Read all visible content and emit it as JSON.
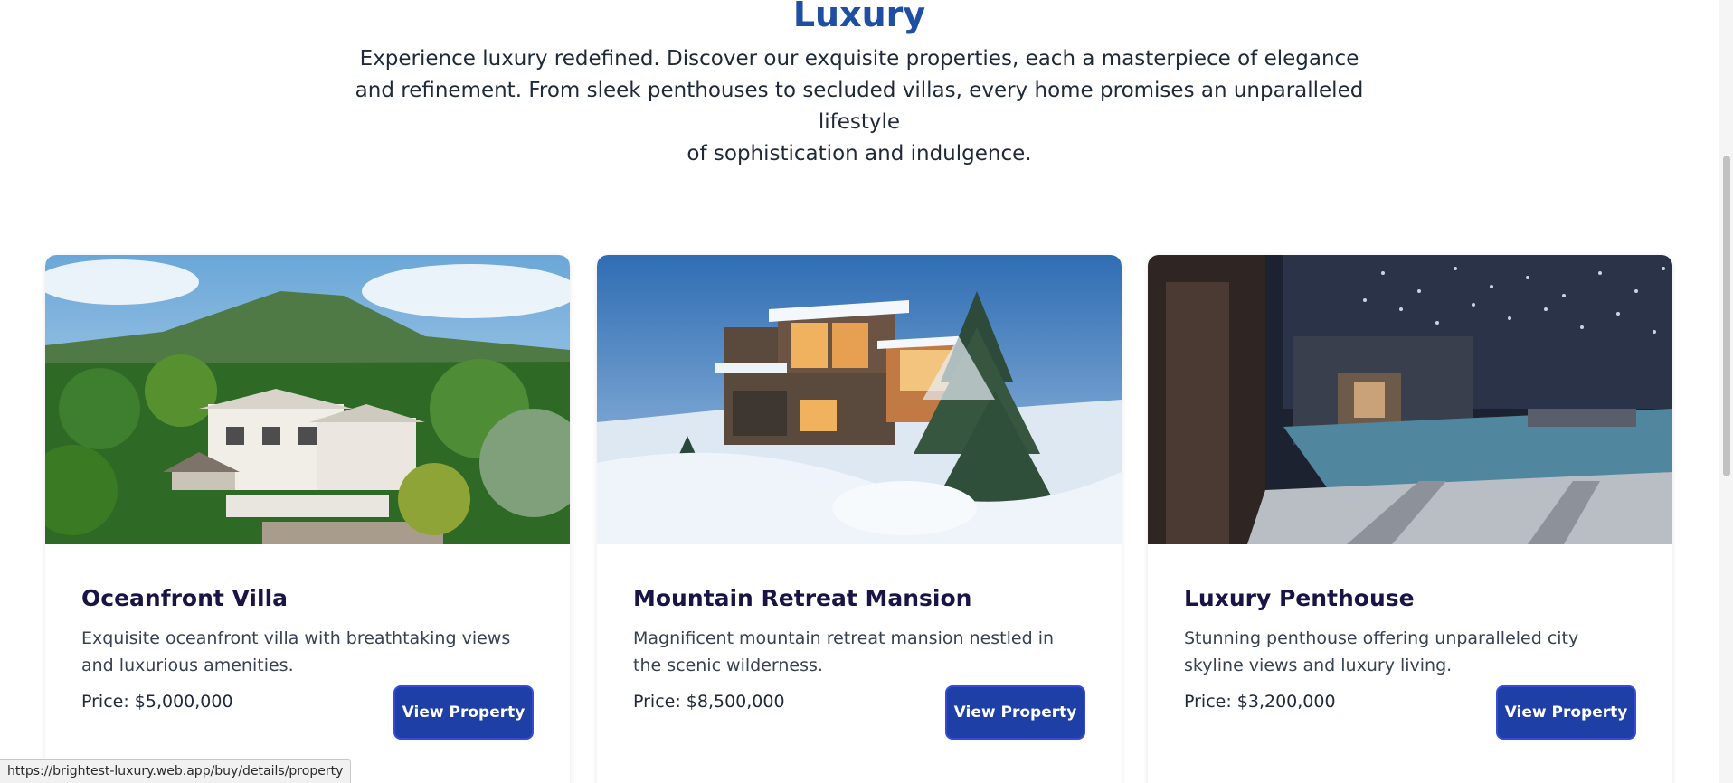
{
  "header": {
    "title": "Luxury",
    "intro_line1": "Experience luxury redefined. Discover our exquisite properties, each a masterpiece of elegance",
    "intro_line2": "and refinement. From sleek penthouses to secluded villas, every home promises an unparalleled lifestyle",
    "intro_line3": "of sophistication and indulgence."
  },
  "properties": [
    {
      "title": "Oceanfront Villa",
      "description": "Exquisite oceanfront villa with breathtaking views and luxurious amenities.",
      "price": "Price: $5,000,000",
      "button_label": "View Property"
    },
    {
      "title": "Mountain Retreat Mansion",
      "description": "Magnificent mountain retreat mansion nestled in the scenic wilderness.",
      "price": "Price: $8,500,000",
      "button_label": "View Property"
    },
    {
      "title": "Luxury Penthouse",
      "description": "Stunning penthouse offering unparalleled city skyline views and luxury living.",
      "price": "Price: $3,200,000",
      "button_label": "View Property"
    }
  ],
  "status_bar": {
    "url": "https://brightest-luxury.web.app/buy/details/property"
  },
  "colors": {
    "accent": "#1e4fa3",
    "button": "#1e3fa6",
    "card_title": "#1a1446"
  }
}
